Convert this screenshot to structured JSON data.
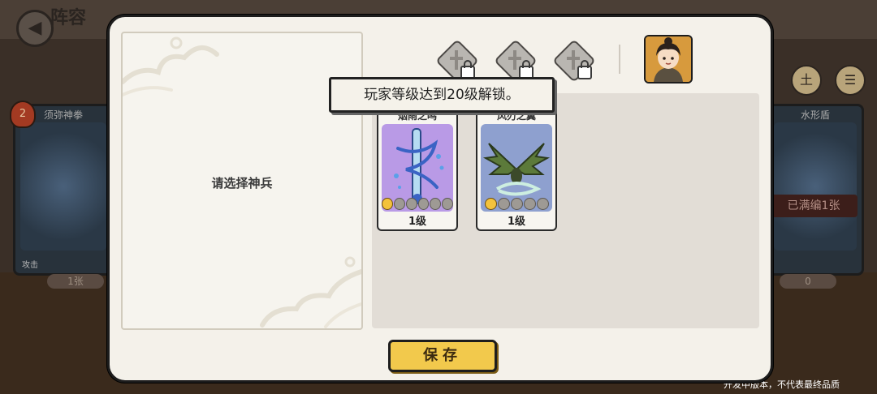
{
  "background": {
    "title": "阵容",
    "cards": [
      {
        "name": "须弥神拳",
        "level": "2",
        "foot": "攻击",
        "count": "1张"
      },
      {
        "name": "水形盾",
        "status": "已满编1张",
        "count": "0"
      }
    ]
  },
  "dialog": {
    "selection_prompt": "请选择神兵",
    "tooltip": "玩家等级达到20级解锁。",
    "locked_slots": [
      {
        "state": "locked",
        "icon": "lock-icon"
      },
      {
        "state": "locked",
        "icon": "lock-icon"
      },
      {
        "state": "locked",
        "icon": "lock-icon"
      }
    ],
    "weapons": [
      {
        "name": "烟雨之鸣",
        "level": "1级",
        "stars": 1,
        "max_stars": 6,
        "theme": "#b99ae6"
      },
      {
        "name": "风刃之翼",
        "level": "1级",
        "stars": 1,
        "max_stars": 5,
        "theme": "#8ea0cf"
      }
    ],
    "save_label": "保存"
  },
  "watermark": "开发中版本，不代表最终品质",
  "colors": {
    "dialog_bg": "#f4f1ea",
    "save_button": "#f2c94c",
    "star_lit": "#f3c23c"
  }
}
